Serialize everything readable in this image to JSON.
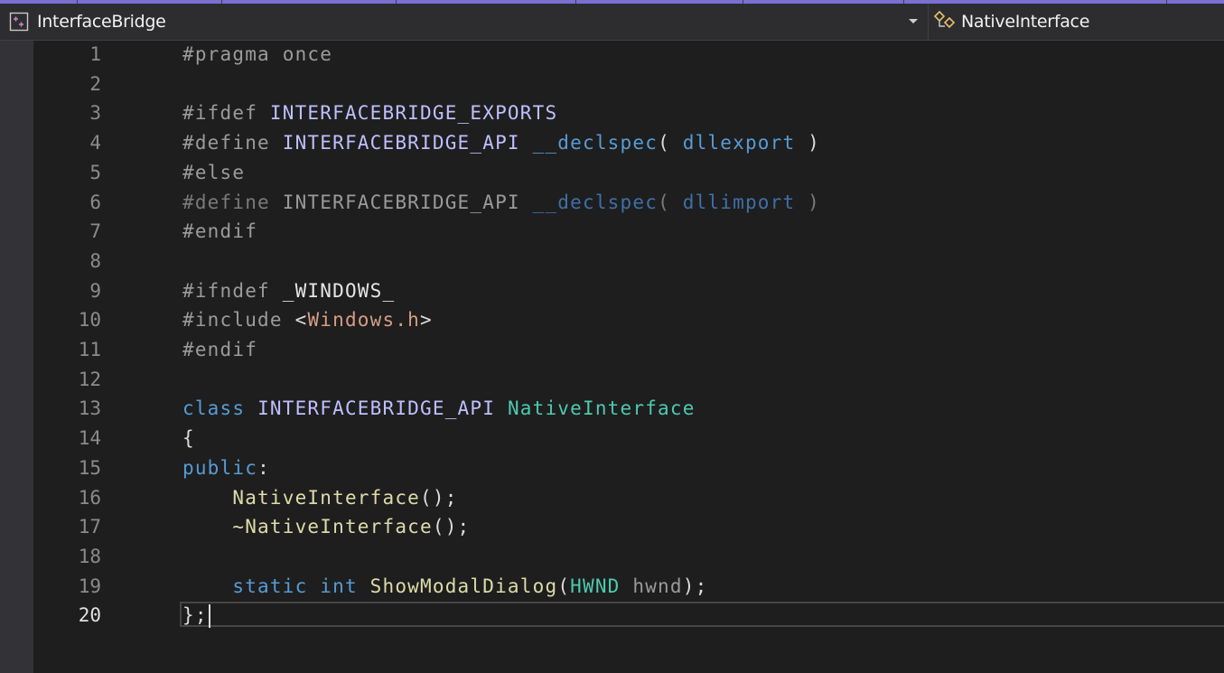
{
  "navbar": {
    "project_label": "InterfaceBridge",
    "project_icon": "cpp-project-icon",
    "dropdown_icon": "chevron-down-icon",
    "class_label": "NativeInterface",
    "class_icon": "class-icon"
  },
  "editor": {
    "current_line": 20,
    "line_numbers": [
      "1",
      "2",
      "3",
      "4",
      "5",
      "6",
      "7",
      "8",
      "9",
      "10",
      "11",
      "12",
      "13",
      "14",
      "15",
      "16",
      "17",
      "18",
      "19",
      "20"
    ],
    "lines": [
      [
        {
          "t": "#pragma once",
          "c": "c-pre"
        }
      ],
      [],
      [
        {
          "t": "#ifdef ",
          "c": "c-pre"
        },
        {
          "t": "INTERFACEBRIDGE_EXPORTS",
          "c": "c-macro"
        }
      ],
      [
        {
          "t": "#define ",
          "c": "c-pre"
        },
        {
          "t": "INTERFACEBRIDGE_API",
          "c": "c-macro"
        },
        {
          "t": " ",
          "c": "c-plain"
        },
        {
          "t": "__declspec",
          "c": "c-kw"
        },
        {
          "t": "( ",
          "c": "c-plain"
        },
        {
          "t": "dllexport",
          "c": "c-kw"
        },
        {
          "t": " )",
          "c": "c-plain"
        }
      ],
      [
        {
          "t": "#else",
          "c": "c-pre"
        }
      ],
      [
        {
          "t": "#define ",
          "c": "c-dim"
        },
        {
          "t": "INTERFACEBRIDGE_API",
          "c": "c-param"
        },
        {
          "t": " ",
          "c": "c-dim"
        },
        {
          "t": "__declspec",
          "c": "c-dimkw"
        },
        {
          "t": "( ",
          "c": "c-dim"
        },
        {
          "t": "dllimport",
          "c": "c-dimkw"
        },
        {
          "t": " )",
          "c": "c-dim"
        }
      ],
      [
        {
          "t": "#endif",
          "c": "c-pre"
        }
      ],
      [],
      [
        {
          "t": "#ifndef ",
          "c": "c-pre"
        },
        {
          "t": "_WINDOWS_",
          "c": "c-tx"
        }
      ],
      [
        {
          "t": "#include ",
          "c": "c-pre"
        },
        {
          "t": "<",
          "c": "c-plain"
        },
        {
          "t": "Windows.h",
          "c": "c-str"
        },
        {
          "t": ">",
          "c": "c-plain"
        }
      ],
      [
        {
          "t": "#endif",
          "c": "c-pre"
        }
      ],
      [],
      [
        {
          "t": "class",
          "c": "c-kw"
        },
        {
          "t": " ",
          "c": "c-plain"
        },
        {
          "t": "INTERFACEBRIDGE_API",
          "c": "c-macro"
        },
        {
          "t": " ",
          "c": "c-plain"
        },
        {
          "t": "NativeInterface",
          "c": "c-type"
        }
      ],
      [
        {
          "t": "{",
          "c": "c-plain"
        }
      ],
      [
        {
          "t": "public",
          "c": "c-kw"
        },
        {
          "t": ":",
          "c": "c-plain"
        }
      ],
      [
        {
          "t": "    ",
          "c": "c-plain"
        },
        {
          "t": "NativeInterface",
          "c": "c-fn"
        },
        {
          "t": "();",
          "c": "c-plain"
        }
      ],
      [
        {
          "t": "    ",
          "c": "c-plain"
        },
        {
          "t": "~NativeInterface",
          "c": "c-fn"
        },
        {
          "t": "();",
          "c": "c-plain"
        }
      ],
      [],
      [
        {
          "t": "    ",
          "c": "c-plain"
        },
        {
          "t": "static",
          "c": "c-kw"
        },
        {
          "t": " ",
          "c": "c-plain"
        },
        {
          "t": "int",
          "c": "c-kw"
        },
        {
          "t": " ",
          "c": "c-plain"
        },
        {
          "t": "ShowModalDialog",
          "c": "c-fn"
        },
        {
          "t": "(",
          "c": "c-plain"
        },
        {
          "t": "HWND",
          "c": "c-type"
        },
        {
          "t": " ",
          "c": "c-plain"
        },
        {
          "t": "hwnd",
          "c": "c-param"
        },
        {
          "t": ");",
          "c": "c-plain"
        }
      ],
      [
        {
          "t": "};",
          "c": "c-plain"
        }
      ]
    ]
  }
}
